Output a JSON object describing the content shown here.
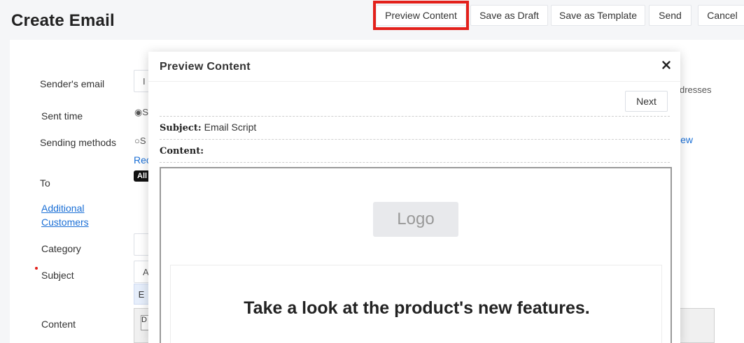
{
  "page": {
    "title": "Create Email"
  },
  "toolbar": {
    "preview": "Preview Content",
    "save_draft": "Save as Draft",
    "save_template": "Save as Template",
    "send": "Send",
    "cancel": "Cancel"
  },
  "form": {
    "sender_label": "Sender's email",
    "sent_time_label": "Sent time",
    "sending_methods_label": "Sending methods",
    "to_label": "To",
    "additional_line1": "Additional",
    "additional_line2": "Customers",
    "category_label": "Category",
    "subject_label": "Subject",
    "content_label": "Content",
    "peek": {
      "sender_input": "I",
      "sent_time_radio": "◉S",
      "sending_radio": "○S",
      "recipients_link": "Rec",
      "all_badge": "All",
      "subject_input": "A",
      "chip": "E",
      "addresses_text": "dresses",
      "view_link": "iew",
      "editor_btn_1": "D"
    }
  },
  "modal": {
    "title": "Preview Content",
    "next": "Next",
    "subject_key": "Subject:",
    "subject_value": "Email Script",
    "content_key": "Content:",
    "logo": "Logo",
    "headline": "Take a look at the product's new features."
  },
  "colors": {
    "highlight": "#e3201b",
    "link": "#1a6fd6",
    "background": "#f5f6f8"
  }
}
